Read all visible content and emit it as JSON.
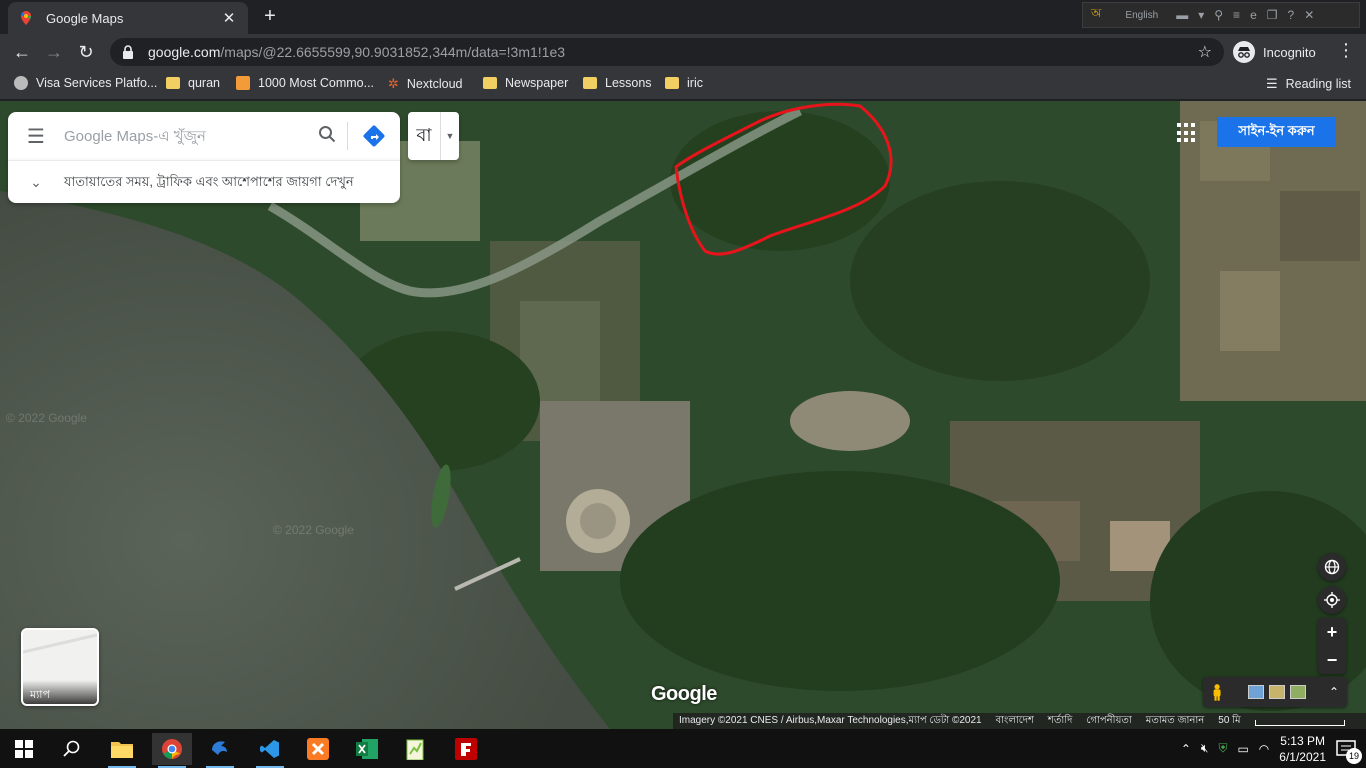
{
  "tab": {
    "title": "Google Maps"
  },
  "extension_bar": {
    "language": "English"
  },
  "omnibox": {
    "host": "google.com",
    "path": "/maps/@22.6655599,90.9031852,344m/data=!3m1!1e3"
  },
  "profile": {
    "label": "Incognito"
  },
  "bookmarks": [
    {
      "label": "Visa Services Platfo...",
      "type": "site"
    },
    {
      "label": "quran",
      "type": "folder"
    },
    {
      "label": "1000 Most Commo...",
      "type": "site"
    },
    {
      "label": "Nextcloud",
      "type": "site"
    },
    {
      "label": "Newspaper",
      "type": "folder"
    },
    {
      "label": "Lessons",
      "type": "folder"
    },
    {
      "label": "iric",
      "type": "folder"
    }
  ],
  "reading_list": "Reading list",
  "maps": {
    "search_placeholder": "Google Maps-এ খুঁজুন",
    "hint": "যাতায়াতের সময়, ট্রাফিক এবং আশেপাশের জায়গা দেখুন",
    "language_short": "বা",
    "sign_in": "সাইন-ইন করুন",
    "layer_label": "ম্যাপ",
    "logo": "Google",
    "watermark": "© 2022 Google",
    "attribution": {
      "imagery": "Imagery ©2021 CNES / Airbus,Maxar Technologies,ম্যাপ ডেটা ©2021",
      "country": "বাংলাদেশ",
      "terms": "শর্তাদি",
      "privacy": "গোপনীয়তা",
      "feedback": "মতামত জানান",
      "scale": "50 মি"
    }
  },
  "taskbar": {
    "time": "5:13 PM",
    "date": "6/1/2021",
    "notifications": "19"
  },
  "colors": {
    "accent": "#1a73e8",
    "annotation": "#e8141c"
  }
}
